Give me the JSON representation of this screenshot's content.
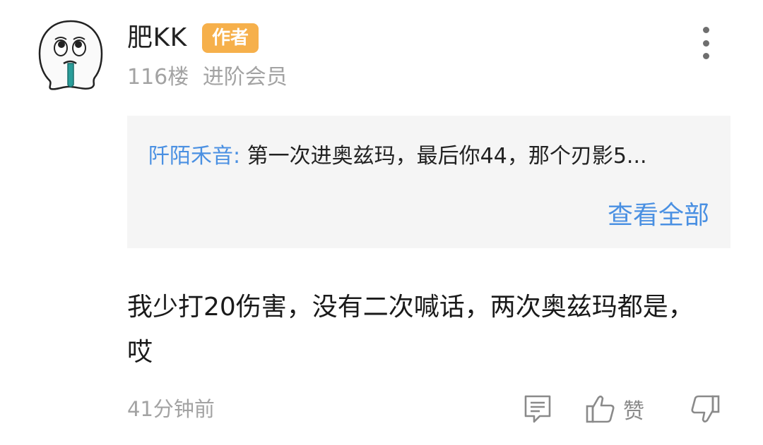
{
  "comment": {
    "username": "肥KK",
    "author_badge": "作者",
    "floor": "116楼",
    "member_level": "进阶会员",
    "quote": {
      "name": "阡陌禾音:",
      "text": "第一次进奥兹玛，最后你44，那个刃影5...",
      "view_all": "查看全部"
    },
    "content": "我少打20伤害，没有二次喊话，两次奥兹玛都是，哎",
    "time": "41分钟前",
    "actions": {
      "like_label": "赞"
    }
  },
  "icons": {
    "avatar": "cartoon-face-avatar",
    "more": "more-vertical-icon",
    "reply": "comment-icon",
    "like": "thumbs-up-icon",
    "dislike": "thumbs-down-icon"
  },
  "colors": {
    "badge": "#f6b04b",
    "link": "#4a90e2",
    "meta": "#a3a3a3",
    "quote_bg": "#f5f5f5"
  }
}
